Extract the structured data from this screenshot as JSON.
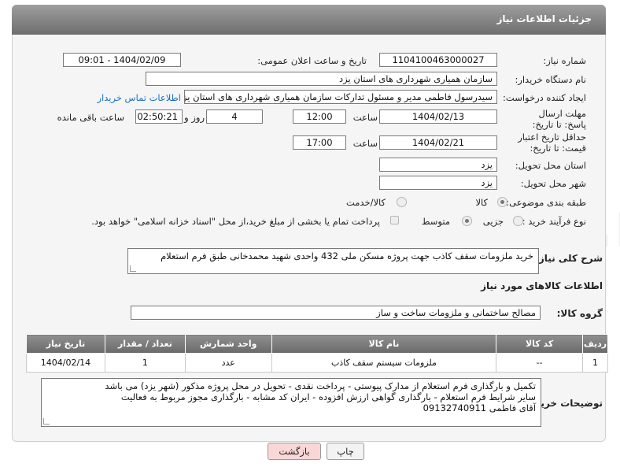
{
  "header": {
    "title": "جزئیات اطلاعات نیاز"
  },
  "fields": {
    "need_number_label": "شماره نیاز:",
    "need_number": "1104100463000027",
    "announce_label": "تاریخ و ساعت اعلان عمومی:",
    "announce_value": "1404/02/09 - 09:01",
    "buyer_org_label": "نام دستگاه خریدار:",
    "buyer_org": "سازمان همیاری شهرداری های استان یزد",
    "creator_label": "ایجاد کننده درخواست:",
    "creator": "سیدرسول فاطمی مدیر و مسئول تدارکات سازمان همیاری شهرداری های استان یزد",
    "contact_link": "اطلاعات تماس خریدار",
    "deadline_label": "مهلت ارسال پاسخ: تا تاریخ:",
    "deadline_date": "1404/02/13",
    "time_label": "ساعت",
    "deadline_time": "12:00",
    "days_value": "4",
    "days_label": "روز و",
    "remaining_time": "02:50:21",
    "remaining_label": "ساعت باقی مانده",
    "min_price_label": "حداقل تاریخ اعتبار قیمت: تا تاریخ:",
    "min_price_date": "1404/02/21",
    "min_price_time": "17:00",
    "province_label": "استان محل تحویل:",
    "province": "یزد",
    "city_label": "شهر محل تحویل:",
    "city": "یزد",
    "category_label": "طبقه بندی موضوعی:",
    "category_options": [
      "کالا",
      "کالا/خدمت"
    ],
    "process_label": "نوع فرآیند خرید :",
    "process_options": [
      "جزیی",
      "متوسط"
    ],
    "payment_note": "پرداخت تمام یا بخشی از مبلغ خرید،از محل \"اسناد خزانه اسلامی\" خواهد بود.",
    "description_label": "شرح کلی نیاز:",
    "description": "خرید ملزومات سقف کاذب جهت پروژه مسکن ملی 432 واحدی شهید محمدخانی طبق فرم استعلام",
    "goods_info_title": "اطلاعات کالاهای مورد نیاز",
    "goods_group_label": "گروه کالا:",
    "goods_group": "مصالح ساختمانی و ملزومات ساخت و ساز"
  },
  "table": {
    "headers": [
      "ردیف",
      "کد کالا",
      "نام کالا",
      "واحد شمارش",
      "تعداد / مقدار",
      "تاریخ نیاز"
    ],
    "rows": [
      [
        "1",
        "--",
        "ملزومات سیستم سقف کاذب",
        "عدد",
        "1",
        "1404/02/14"
      ]
    ]
  },
  "buyer_notes": {
    "label": "توضیحات خریدار:",
    "lines": [
      "تکمیل و بارگذاری فرم استعلام از مدارک پیوستی - پرداخت نقدی - تحویل در محل پروژه مذکور (شهر یزد) می باشد",
      "سایر شرایط فرم استعلام - بارگذاری گواهی ارزش افزوده - ایران کد مشابه - بارگذاری مجوز مربوط به فعالیت",
      "آقای فاطمی 09132740911"
    ]
  },
  "buttons": {
    "print": "چاپ",
    "back": "بازگشت"
  },
  "colors": {
    "header_bg": "#7d7d7d",
    "link": "#1c6ec4",
    "back_btn_bg": "#f9d7d7",
    "watermark": "#e6e6e6"
  }
}
